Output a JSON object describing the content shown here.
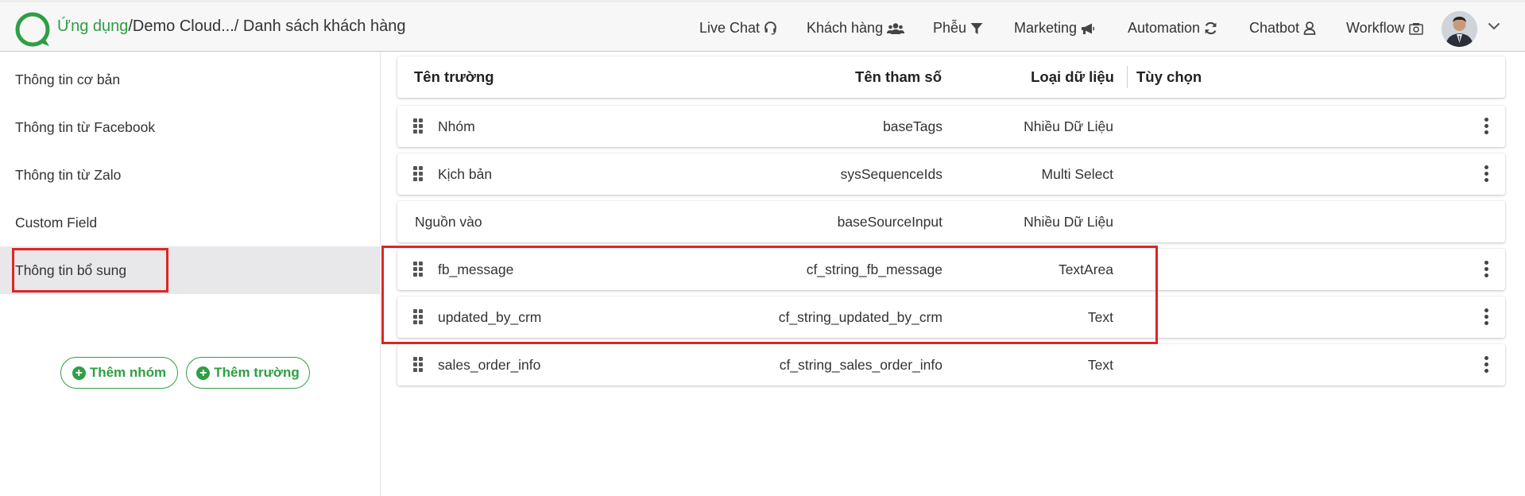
{
  "header": {
    "breadcrumb_app": "Ứng dụng",
    "breadcrumb_rest": "/Demo Cloud.../ Danh sách khách hàng",
    "nav": [
      {
        "label": "Live Chat",
        "icon": "headset-icon"
      },
      {
        "label": "Khách hàng",
        "icon": "users-icon"
      },
      {
        "label": "Phễu",
        "icon": "funnel-icon"
      },
      {
        "label": "Marketing",
        "icon": "megaphone-icon"
      },
      {
        "label": "Automation",
        "icon": "sync-icon"
      },
      {
        "label": "Chatbot",
        "icon": "bot-icon"
      },
      {
        "label": "Workflow",
        "icon": "workflow-icon"
      }
    ]
  },
  "sidebar": {
    "items": [
      {
        "label": "Thông tin cơ bản"
      },
      {
        "label": "Thông tin từ Facebook"
      },
      {
        "label": "Thông tin từ Zalo"
      },
      {
        "label": "Custom Field"
      },
      {
        "label": "Thông tin bổ sung",
        "active": true
      }
    ],
    "add_group_label": "Thêm nhóm",
    "add_field_label": "Thêm trường"
  },
  "table": {
    "headers": {
      "name": "Tên trường",
      "param": "Tên tham số",
      "type": "Loại dữ liệu",
      "options": "Tùy chọn"
    },
    "rows": [
      {
        "name": "Nhóm",
        "param": "baseTags",
        "type": "Nhiều Dữ Liệu"
      },
      {
        "name": "Kịch bản",
        "param": "sysSequenceIds",
        "type": "Multi Select"
      },
      {
        "name": "Nguồn vào",
        "param": "baseSourceInput",
        "type": "Nhiều Dữ Liệu"
      },
      {
        "name": "fb_message",
        "param": "cf_string_fb_message",
        "type": "TextArea"
      },
      {
        "name": "updated_by_crm",
        "param": "cf_string_updated_by_crm",
        "type": "Text"
      },
      {
        "name": "sales_order_info",
        "param": "cf_string_sales_order_info",
        "type": "Text"
      }
    ]
  },
  "colors": {
    "brand": "#2f9e44",
    "highlight": "#e02424",
    "active_bg": "#e8e8ea"
  }
}
